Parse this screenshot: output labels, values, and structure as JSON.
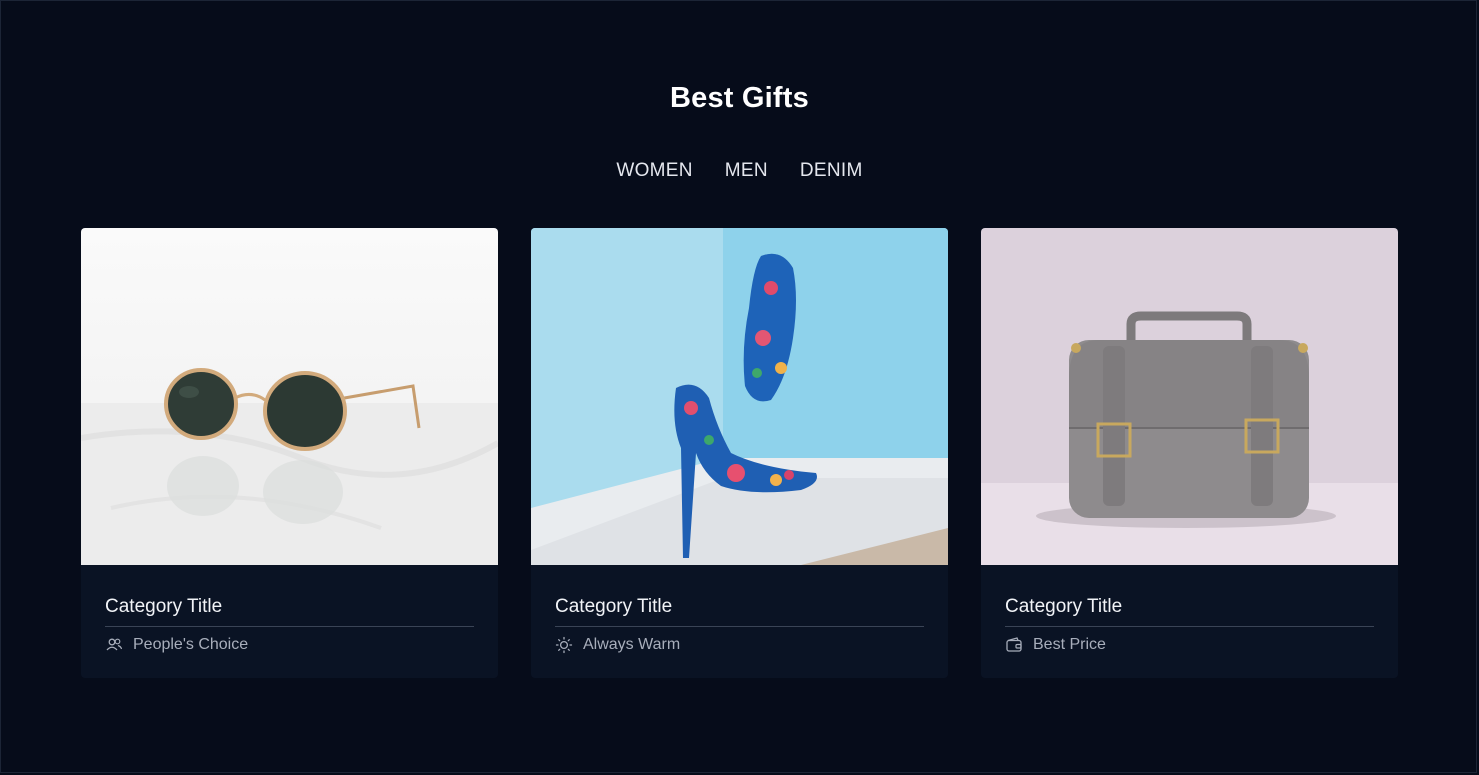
{
  "page": {
    "title": "Best Gifts"
  },
  "tabs": [
    {
      "label": "WOMEN"
    },
    {
      "label": "MEN"
    },
    {
      "label": "DENIM"
    }
  ],
  "cards": [
    {
      "title": "Category Title",
      "meta": "People's Choice",
      "icon": "people-icon",
      "image": "sunglasses"
    },
    {
      "title": "Category Title",
      "meta": "Always Warm",
      "icon": "sun-icon",
      "image": "high-heel-shoes"
    },
    {
      "title": "Category Title",
      "meta": "Best Price",
      "icon": "wallet-icon",
      "image": "leather-satchel"
    }
  ],
  "colors": {
    "background": "#060c1a",
    "card": "#0a1324"
  }
}
